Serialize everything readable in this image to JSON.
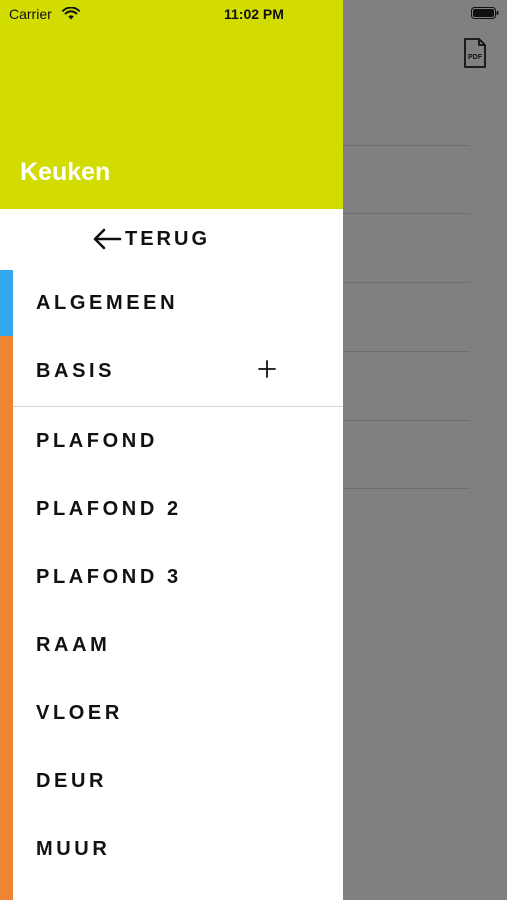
{
  "status_bar": {
    "carrier": "Carrier",
    "time": "11:02 PM"
  },
  "background": {
    "pdf_icon_label": "PDF"
  },
  "drawer": {
    "header_color": "#d2dc00",
    "room_title": "Keuken",
    "back_label": "TERUG",
    "section_colors": {
      "active": "#33a8ef",
      "rest": "#ef8433"
    },
    "items": [
      "ALGEMEEN",
      "BASIS",
      "PLAFOND",
      "PLAFOND 2",
      "PLAFOND 3",
      "RAAM",
      "VLOER",
      "DEUR",
      "MUUR"
    ],
    "basis_action_icon": "plus-icon"
  }
}
